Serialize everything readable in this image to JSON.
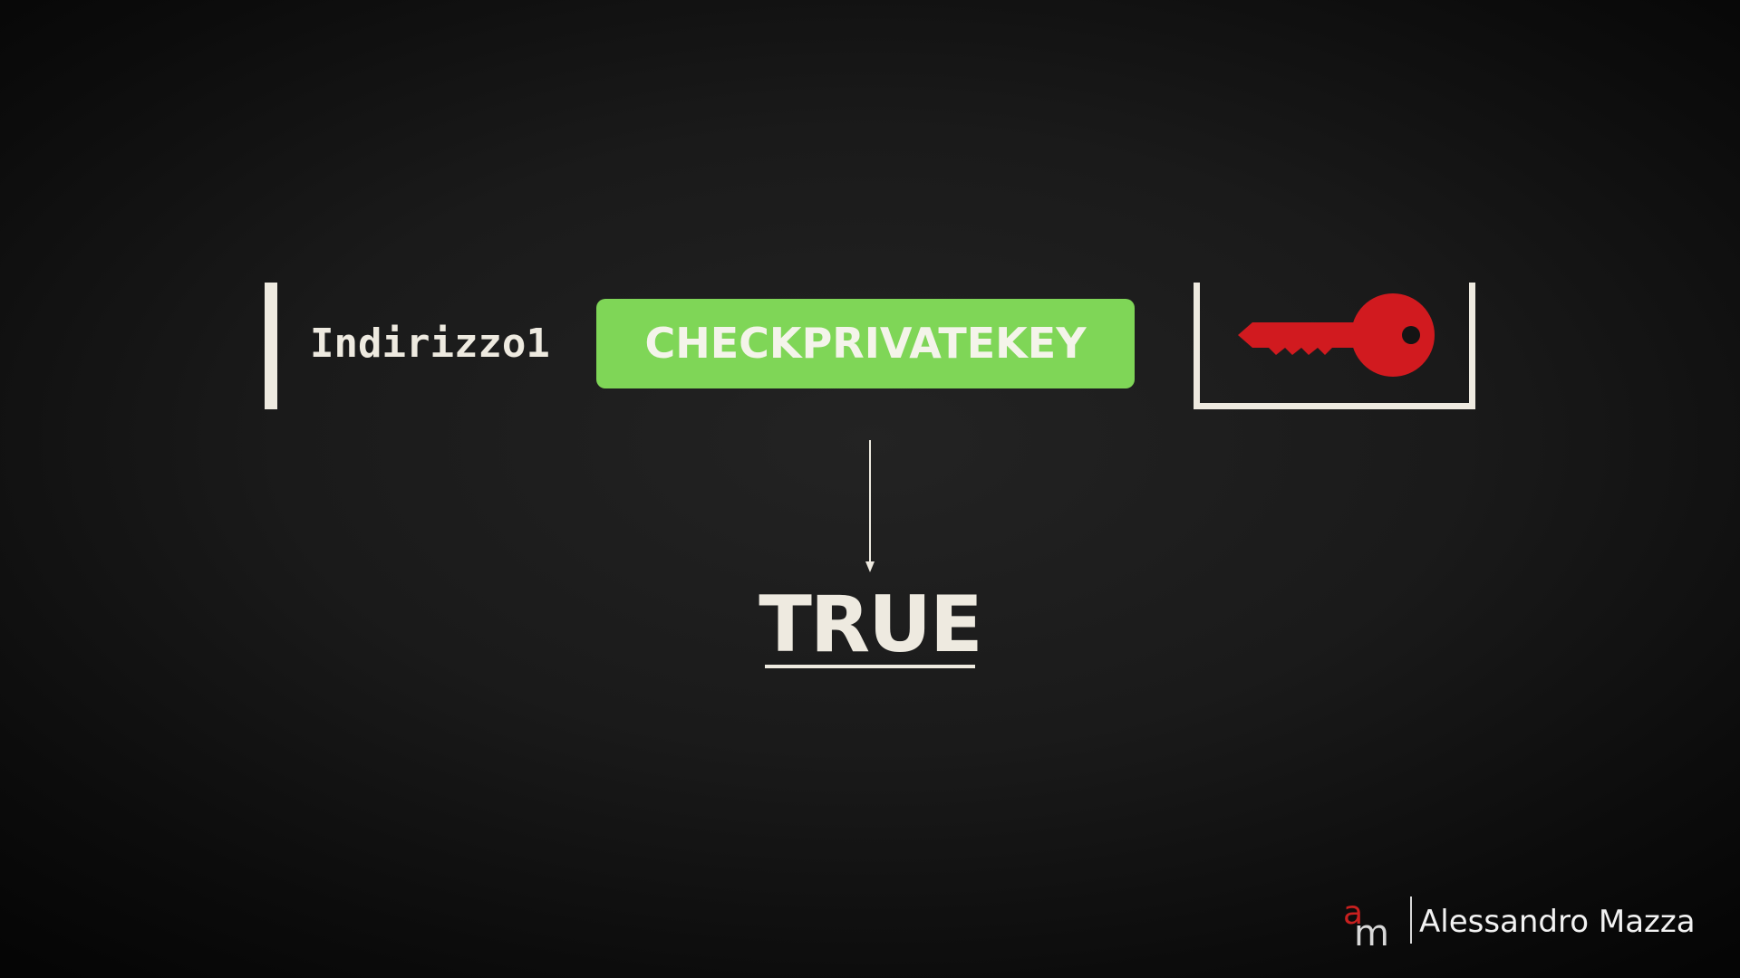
{
  "diagram": {
    "stack_item_address": "Indirizzo1",
    "opcode": "CHECKPRIVATEKEY",
    "result": "TRUE",
    "key_icon": "key-icon",
    "arrow_icon": "arrow-down-icon"
  },
  "branding": {
    "logo_letters": "am",
    "author": "Alessandro Mazza"
  },
  "colors": {
    "background": "#1a1a1a",
    "bracket": "#eeeae0",
    "opcode_fill": "#7fd657",
    "key": "#d11a1f",
    "logo_accent": "#c8201f"
  }
}
